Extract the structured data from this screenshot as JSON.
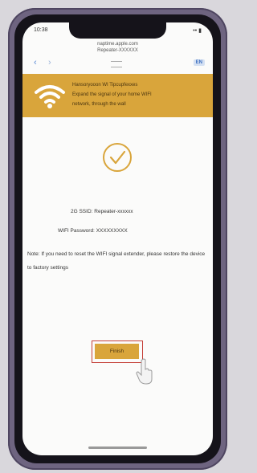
{
  "status_bar": {
    "time": "10:38",
    "right": "•• ▮"
  },
  "url": {
    "line1": "naptime.apple.com",
    "line2": "Repeater-XXXXXX"
  },
  "browser": {
    "back": "‹",
    "forward": "›",
    "lang_badge": "EN"
  },
  "banner": {
    "icon": "wifi-icon",
    "title": "Hansoryooon WI Tipcupfexxes",
    "line2": "Expand the signal of your home WIFI",
    "line3": "network, through the wall"
  },
  "result": {
    "icon": "check-circle-icon",
    "ssid_label": "2G SSID:",
    "ssid_value": "Repeater-xxxxxx",
    "password_label": "WIFI Password:",
    "password_value": "XXXXXXXXX"
  },
  "note": "Note: If you need to reset the WIFI signal extender, please restore the device to factory settings",
  "finish_button": {
    "label": "Finish"
  },
  "colors": {
    "accent": "#d9a53b",
    "highlight": "#c54039",
    "link": "#5a8bd6"
  }
}
